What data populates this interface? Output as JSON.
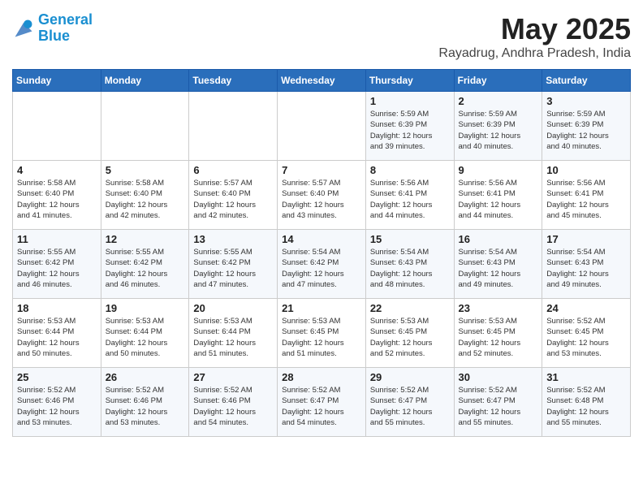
{
  "logo": {
    "line1": "General",
    "line2": "Blue"
  },
  "title": "May 2025",
  "location": "Rayadrug, Andhra Pradesh, India",
  "weekdays": [
    "Sunday",
    "Monday",
    "Tuesday",
    "Wednesday",
    "Thursday",
    "Friday",
    "Saturday"
  ],
  "weeks": [
    [
      {
        "day": "",
        "info": ""
      },
      {
        "day": "",
        "info": ""
      },
      {
        "day": "",
        "info": ""
      },
      {
        "day": "",
        "info": ""
      },
      {
        "day": "1",
        "info": "Sunrise: 5:59 AM\nSunset: 6:39 PM\nDaylight: 12 hours\nand 39 minutes."
      },
      {
        "day": "2",
        "info": "Sunrise: 5:59 AM\nSunset: 6:39 PM\nDaylight: 12 hours\nand 40 minutes."
      },
      {
        "day": "3",
        "info": "Sunrise: 5:59 AM\nSunset: 6:39 PM\nDaylight: 12 hours\nand 40 minutes."
      }
    ],
    [
      {
        "day": "4",
        "info": "Sunrise: 5:58 AM\nSunset: 6:40 PM\nDaylight: 12 hours\nand 41 minutes."
      },
      {
        "day": "5",
        "info": "Sunrise: 5:58 AM\nSunset: 6:40 PM\nDaylight: 12 hours\nand 42 minutes."
      },
      {
        "day": "6",
        "info": "Sunrise: 5:57 AM\nSunset: 6:40 PM\nDaylight: 12 hours\nand 42 minutes."
      },
      {
        "day": "7",
        "info": "Sunrise: 5:57 AM\nSunset: 6:40 PM\nDaylight: 12 hours\nand 43 minutes."
      },
      {
        "day": "8",
        "info": "Sunrise: 5:56 AM\nSunset: 6:41 PM\nDaylight: 12 hours\nand 44 minutes."
      },
      {
        "day": "9",
        "info": "Sunrise: 5:56 AM\nSunset: 6:41 PM\nDaylight: 12 hours\nand 44 minutes."
      },
      {
        "day": "10",
        "info": "Sunrise: 5:56 AM\nSunset: 6:41 PM\nDaylight: 12 hours\nand 45 minutes."
      }
    ],
    [
      {
        "day": "11",
        "info": "Sunrise: 5:55 AM\nSunset: 6:42 PM\nDaylight: 12 hours\nand 46 minutes."
      },
      {
        "day": "12",
        "info": "Sunrise: 5:55 AM\nSunset: 6:42 PM\nDaylight: 12 hours\nand 46 minutes."
      },
      {
        "day": "13",
        "info": "Sunrise: 5:55 AM\nSunset: 6:42 PM\nDaylight: 12 hours\nand 47 minutes."
      },
      {
        "day": "14",
        "info": "Sunrise: 5:54 AM\nSunset: 6:42 PM\nDaylight: 12 hours\nand 47 minutes."
      },
      {
        "day": "15",
        "info": "Sunrise: 5:54 AM\nSunset: 6:43 PM\nDaylight: 12 hours\nand 48 minutes."
      },
      {
        "day": "16",
        "info": "Sunrise: 5:54 AM\nSunset: 6:43 PM\nDaylight: 12 hours\nand 49 minutes."
      },
      {
        "day": "17",
        "info": "Sunrise: 5:54 AM\nSunset: 6:43 PM\nDaylight: 12 hours\nand 49 minutes."
      }
    ],
    [
      {
        "day": "18",
        "info": "Sunrise: 5:53 AM\nSunset: 6:44 PM\nDaylight: 12 hours\nand 50 minutes."
      },
      {
        "day": "19",
        "info": "Sunrise: 5:53 AM\nSunset: 6:44 PM\nDaylight: 12 hours\nand 50 minutes."
      },
      {
        "day": "20",
        "info": "Sunrise: 5:53 AM\nSunset: 6:44 PM\nDaylight: 12 hours\nand 51 minutes."
      },
      {
        "day": "21",
        "info": "Sunrise: 5:53 AM\nSunset: 6:45 PM\nDaylight: 12 hours\nand 51 minutes."
      },
      {
        "day": "22",
        "info": "Sunrise: 5:53 AM\nSunset: 6:45 PM\nDaylight: 12 hours\nand 52 minutes."
      },
      {
        "day": "23",
        "info": "Sunrise: 5:53 AM\nSunset: 6:45 PM\nDaylight: 12 hours\nand 52 minutes."
      },
      {
        "day": "24",
        "info": "Sunrise: 5:52 AM\nSunset: 6:45 PM\nDaylight: 12 hours\nand 53 minutes."
      }
    ],
    [
      {
        "day": "25",
        "info": "Sunrise: 5:52 AM\nSunset: 6:46 PM\nDaylight: 12 hours\nand 53 minutes."
      },
      {
        "day": "26",
        "info": "Sunrise: 5:52 AM\nSunset: 6:46 PM\nDaylight: 12 hours\nand 53 minutes."
      },
      {
        "day": "27",
        "info": "Sunrise: 5:52 AM\nSunset: 6:46 PM\nDaylight: 12 hours\nand 54 minutes."
      },
      {
        "day": "28",
        "info": "Sunrise: 5:52 AM\nSunset: 6:47 PM\nDaylight: 12 hours\nand 54 minutes."
      },
      {
        "day": "29",
        "info": "Sunrise: 5:52 AM\nSunset: 6:47 PM\nDaylight: 12 hours\nand 55 minutes."
      },
      {
        "day": "30",
        "info": "Sunrise: 5:52 AM\nSunset: 6:47 PM\nDaylight: 12 hours\nand 55 minutes."
      },
      {
        "day": "31",
        "info": "Sunrise: 5:52 AM\nSunset: 6:48 PM\nDaylight: 12 hours\nand 55 minutes."
      }
    ]
  ]
}
